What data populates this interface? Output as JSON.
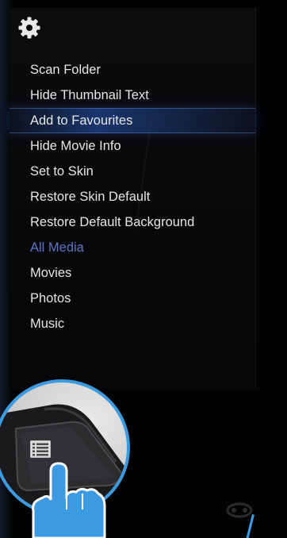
{
  "menu": {
    "items": [
      {
        "label": "Scan Folder",
        "state": "normal"
      },
      {
        "label": "Hide Thumbnail Text",
        "state": "normal"
      },
      {
        "label": "Add to Favourites",
        "state": "selected"
      },
      {
        "label": "Hide Movie Info",
        "state": "normal"
      },
      {
        "label": "Set to Skin",
        "state": "normal"
      },
      {
        "label": "Restore Skin Default",
        "state": "normal"
      },
      {
        "label": "Restore Default Background",
        "state": "normal"
      },
      {
        "label": "All Media",
        "state": "active"
      },
      {
        "label": "Movies",
        "state": "normal"
      },
      {
        "label": "Photos",
        "state": "normal"
      },
      {
        "label": "Music",
        "state": "normal"
      }
    ]
  },
  "icons": {
    "settings": "gear-icon",
    "menu_button": "list-icon",
    "remote": "remote-icon"
  },
  "colors": {
    "highlight": "#2f62c0",
    "active_text": "#5a74c8",
    "callout": "#3c9ae0"
  }
}
